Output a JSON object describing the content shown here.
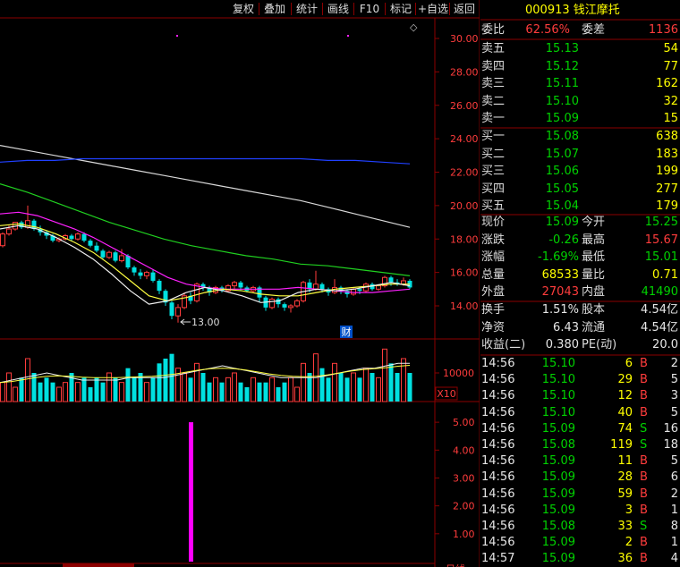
{
  "toolbar": {
    "buttons": [
      "复权",
      "叠加",
      "统计",
      "画线",
      "F10",
      "标记",
      "+自选",
      "返回"
    ]
  },
  "stock": {
    "code": "000913",
    "name": "钱江摩托"
  },
  "main_chart": {
    "price_ticks": [
      "30.00",
      "28.00",
      "26.00",
      "24.00",
      "22.00",
      "20.00",
      "18.00",
      "16.00",
      "14.00"
    ],
    "low_marker": "13.00",
    "finance_marker": "财",
    "diamond": "◇",
    "candles": [
      {
        "o": 17.6,
        "c": 18.3,
        "h": 18.4,
        "l": 17.5
      },
      {
        "o": 18.3,
        "c": 18.6,
        "h": 18.8,
        "l": 18.2
      },
      {
        "o": 18.6,
        "c": 19.0,
        "h": 19.0,
        "l": 18.5
      },
      {
        "o": 19.0,
        "c": 18.7,
        "h": 19.1,
        "l": 18.6
      },
      {
        "o": 18.7,
        "c": 19.1,
        "h": 20.0,
        "l": 18.6
      },
      {
        "o": 19.1,
        "c": 18.6,
        "h": 19.2,
        "l": 18.5
      },
      {
        "o": 18.6,
        "c": 18.4,
        "h": 18.8,
        "l": 18.2
      },
      {
        "o": 18.4,
        "c": 18.2,
        "h": 18.5,
        "l": 18.0
      },
      {
        "o": 18.2,
        "c": 17.9,
        "h": 18.3,
        "l": 17.8
      },
      {
        "o": 17.9,
        "c": 18.0,
        "h": 18.1,
        "l": 17.8
      },
      {
        "o": 18.0,
        "c": 18.2,
        "h": 18.3,
        "l": 17.9
      },
      {
        "o": 18.2,
        "c": 18.0,
        "h": 18.3,
        "l": 17.9
      },
      {
        "o": 18.0,
        "c": 18.3,
        "h": 18.4,
        "l": 17.9
      },
      {
        "o": 18.3,
        "c": 17.9,
        "h": 18.4,
        "l": 17.8
      },
      {
        "o": 17.9,
        "c": 17.6,
        "h": 18.0,
        "l": 17.5
      },
      {
        "o": 17.6,
        "c": 17.3,
        "h": 17.8,
        "l": 17.2
      },
      {
        "o": 17.3,
        "c": 16.9,
        "h": 17.4,
        "l": 16.8
      },
      {
        "o": 16.9,
        "c": 17.2,
        "h": 17.3,
        "l": 16.8
      },
      {
        "o": 17.2,
        "c": 16.7,
        "h": 17.3,
        "l": 16.6
      },
      {
        "o": 16.7,
        "c": 17.0,
        "h": 17.4,
        "l": 16.6
      },
      {
        "o": 17.0,
        "c": 16.3,
        "h": 17.1,
        "l": 16.2
      },
      {
        "o": 16.3,
        "c": 16.0,
        "h": 16.4,
        "l": 15.8
      },
      {
        "o": 16.0,
        "c": 15.8,
        "h": 16.2,
        "l": 15.6
      },
      {
        "o": 15.8,
        "c": 16.0,
        "h": 16.1,
        "l": 15.6
      },
      {
        "o": 16.0,
        "c": 15.5,
        "h": 16.2,
        "l": 15.4
      },
      {
        "o": 15.5,
        "c": 14.9,
        "h": 15.6,
        "l": 14.7
      },
      {
        "o": 14.9,
        "c": 14.2,
        "h": 15.0,
        "l": 14.0
      },
      {
        "o": 14.2,
        "c": 13.4,
        "h": 14.3,
        "l": 13.2
      },
      {
        "o": 13.4,
        "c": 13.9,
        "h": 14.1,
        "l": 13.0
      },
      {
        "o": 13.9,
        "c": 14.6,
        "h": 14.8,
        "l": 13.8
      },
      {
        "o": 14.6,
        "c": 14.3,
        "h": 14.8,
        "l": 14.1
      },
      {
        "o": 14.3,
        "c": 15.3,
        "h": 15.4,
        "l": 14.2
      },
      {
        "o": 15.3,
        "c": 15.1,
        "h": 15.4,
        "l": 14.9
      },
      {
        "o": 15.1,
        "c": 14.8,
        "h": 15.2,
        "l": 14.6
      },
      {
        "o": 14.8,
        "c": 15.1,
        "h": 15.2,
        "l": 14.7
      },
      {
        "o": 15.1,
        "c": 14.9,
        "h": 15.2,
        "l": 14.8
      },
      {
        "o": 14.9,
        "c": 15.2,
        "h": 15.3,
        "l": 14.8
      },
      {
        "o": 15.2,
        "c": 15.4,
        "h": 15.5,
        "l": 15.0
      },
      {
        "o": 15.4,
        "c": 15.1,
        "h": 15.5,
        "l": 14.9
      },
      {
        "o": 15.1,
        "c": 14.9,
        "h": 15.2,
        "l": 14.8
      },
      {
        "o": 14.9,
        "c": 15.1,
        "h": 15.2,
        "l": 14.8
      },
      {
        "o": 15.1,
        "c": 14.5,
        "h": 15.2,
        "l": 14.2
      },
      {
        "o": 14.5,
        "c": 13.9,
        "h": 14.6,
        "l": 13.7
      },
      {
        "o": 13.9,
        "c": 14.4,
        "h": 14.5,
        "l": 13.8
      },
      {
        "o": 14.4,
        "c": 14.1,
        "h": 14.5,
        "l": 13.9
      },
      {
        "o": 14.1,
        "c": 13.9,
        "h": 14.2,
        "l": 13.7
      },
      {
        "o": 13.9,
        "c": 14.0,
        "h": 14.1,
        "l": 13.6
      },
      {
        "o": 14.0,
        "c": 14.3,
        "h": 14.4,
        "l": 13.9
      },
      {
        "o": 14.3,
        "c": 15.4,
        "h": 15.5,
        "l": 14.2
      },
      {
        "o": 15.4,
        "c": 15.0,
        "h": 15.6,
        "l": 14.8
      },
      {
        "o": 15.0,
        "c": 15.3,
        "h": 16.1,
        "l": 14.9
      },
      {
        "o": 15.3,
        "c": 15.0,
        "h": 15.4,
        "l": 14.8
      },
      {
        "o": 15.0,
        "c": 14.8,
        "h": 15.1,
        "l": 14.6
      },
      {
        "o": 14.8,
        "c": 15.1,
        "h": 15.6,
        "l": 14.7
      },
      {
        "o": 15.1,
        "c": 14.9,
        "h": 15.2,
        "l": 14.7
      },
      {
        "o": 14.9,
        "c": 14.7,
        "h": 15.0,
        "l": 14.5
      },
      {
        "o": 14.7,
        "c": 15.0,
        "h": 15.1,
        "l": 14.6
      },
      {
        "o": 15.0,
        "c": 14.9,
        "h": 15.1,
        "l": 14.7
      },
      {
        "o": 14.9,
        "c": 15.3,
        "h": 15.4,
        "l": 14.8
      },
      {
        "o": 15.3,
        "c": 15.0,
        "h": 15.4,
        "l": 14.9
      },
      {
        "o": 15.0,
        "c": 15.2,
        "h": 15.3,
        "l": 14.9
      },
      {
        "o": 15.2,
        "c": 15.7,
        "h": 15.8,
        "l": 15.1
      },
      {
        "o": 15.7,
        "c": 15.4,
        "h": 15.8,
        "l": 15.2
      },
      {
        "o": 15.4,
        "c": 15.3,
        "h": 15.6,
        "l": 15.2
      },
      {
        "o": 15.3,
        "c": 15.5,
        "h": 15.7,
        "l": 15.2
      },
      {
        "o": 15.5,
        "c": 15.1,
        "h": 15.6,
        "l": 15.0
      }
    ],
    "ma_white": [
      23.6,
      23.3,
      23.0,
      22.7,
      22.4,
      22.1,
      21.8,
      21.5,
      21.2,
      20.9,
      20.6,
      20.3,
      19.9,
      19.5,
      19.1,
      18.7
    ],
    "ma_blue": [
      22.6,
      22.7,
      22.7,
      22.8,
      22.8,
      22.8,
      22.8,
      22.8,
      22.8,
      22.8,
      22.8,
      22.8,
      22.7,
      22.7,
      22.6,
      22.5
    ],
    "ma_green": [
      21.3,
      20.8,
      20.2,
      19.6,
      19.0,
      18.5,
      18.0,
      17.6,
      17.3,
      17.0,
      16.8,
      16.5,
      16.4,
      16.2,
      16.0,
      15.8
    ],
    "ma_magenta": [
      19.5,
      19.6,
      19.4,
      19.0,
      18.6,
      18.1,
      17.5,
      16.9,
      16.3,
      15.7,
      15.3,
      15.1,
      15.0,
      15.0,
      15.0,
      15.0,
      15.1,
      15.0,
      14.9,
      14.8,
      14.8,
      14.9,
      15.0
    ],
    "ma_yellow": [
      18.8,
      18.9,
      18.7,
      18.3,
      17.8,
      17.2,
      16.4,
      15.5,
      14.6,
      14.3,
      14.5,
      14.8,
      15.0,
      14.9,
      14.7,
      14.6,
      14.6,
      14.8,
      15.0,
      15.1,
      15.2,
      15.3,
      15.3
    ],
    "ma_cream": [
      18.6,
      18.8,
      18.6,
      18.1,
      17.5,
      16.8,
      15.9,
      14.9,
      14.1,
      14.3,
      14.8,
      15.1,
      14.9,
      14.6,
      14.2,
      14.3,
      14.8,
      15.0,
      14.9,
      15.0,
      15.2,
      15.4,
      15.2
    ]
  },
  "volume_chart": {
    "tick": "10000",
    "multiplier": "X10",
    "bars": [
      4,
      6,
      3,
      5,
      9,
      6,
      4,
      5,
      4,
      3,
      4,
      6,
      4,
      5,
      3,
      5,
      4,
      6,
      5,
      4,
      7,
      5,
      6,
      4,
      5,
      8,
      9,
      10,
      7,
      6,
      5,
      8,
      6,
      4,
      5,
      4,
      5,
      6,
      4,
      3,
      5,
      4,
      4,
      5,
      3,
      4,
      5,
      3,
      8,
      6,
      10,
      7,
      5,
      8,
      6,
      5,
      6,
      5,
      7,
      6,
      5,
      11,
      8,
      6,
      9,
      6
    ],
    "ma1": [
      4,
      4.5,
      5,
      5.5,
      6,
      5.5,
      5,
      4.5,
      4.5,
      4.5,
      4.5,
      5,
      5,
      5,
      5,
      5.5,
      6,
      6.5,
      7,
      7.5,
      7,
      6.5,
      6,
      5.5,
      5,
      5,
      5,
      5,
      5.5,
      6,
      6.5,
      7,
      7,
      7.5,
      8,
      8
    ],
    "ma2": [
      4,
      4.2,
      4.6,
      5,
      5.3,
      5.4,
      5.3,
      5.1,
      5,
      5,
      5,
      5.1,
      5.2,
      5.3,
      5.5,
      5.8,
      6.2,
      6.6,
      6.9,
      7,
      6.9,
      6.6,
      6.2,
      5.8,
      5.5,
      5.3,
      5.2,
      5.3,
      5.6,
      6,
      6.4,
      6.7,
      6.9,
      7.1,
      7.4,
      7.6
    ]
  },
  "indicator_chart": {
    "ticks": [
      "5.00",
      "4.00",
      "3.00",
      "2.00",
      "1.00"
    ],
    "bar_value": 5.0,
    "bottom_label": "日线"
  },
  "quote": {
    "weibi_label": "委比",
    "weibi": "62.56%",
    "weicha_label": "委差",
    "weicha": "1136",
    "sell": [
      {
        "label": "卖五",
        "price": "15.13",
        "vol": "54"
      },
      {
        "label": "卖四",
        "price": "15.12",
        "vol": "77"
      },
      {
        "label": "卖三",
        "price": "15.11",
        "vol": "162"
      },
      {
        "label": "卖二",
        "price": "15.10",
        "vol": "32"
      },
      {
        "label": "卖一",
        "price": "15.09",
        "vol": "15"
      }
    ],
    "buy": [
      {
        "label": "买一",
        "price": "15.08",
        "vol": "638"
      },
      {
        "label": "买二",
        "price": "15.07",
        "vol": "183"
      },
      {
        "label": "买三",
        "price": "15.06",
        "vol": "199"
      },
      {
        "label": "买四",
        "price": "15.05",
        "vol": "277"
      },
      {
        "label": "买五",
        "price": "15.04",
        "vol": "179"
      }
    ],
    "stats": [
      {
        "l1": "现价",
        "v1": "15.09",
        "c1": "dn",
        "l2": "今开",
        "v2": "15.25",
        "c2": "dn"
      },
      {
        "l1": "涨跌",
        "v1": "-0.26",
        "c1": "dn",
        "l2": "最高",
        "v2": "15.67",
        "c2": "up"
      },
      {
        "l1": "涨幅",
        "v1": "-1.69%",
        "c1": "dn",
        "l2": "最低",
        "v2": "15.01",
        "c2": "dn"
      },
      {
        "l1": "总量",
        "v1": "68533",
        "c1": "yel",
        "l2": "量比",
        "v2": "0.71",
        "c2": "yel"
      },
      {
        "l1": "外盘",
        "v1": "27043",
        "c1": "up",
        "l2": "内盘",
        "v2": "41490",
        "c2": "dn"
      }
    ],
    "finance": [
      {
        "l1": "换手",
        "v1": "1.51%",
        "l2": "股本",
        "v2": "4.54亿"
      },
      {
        "l1": "净资",
        "v1": "6.43",
        "l2": "流通",
        "v2": "4.54亿"
      },
      {
        "l1": "收益(二)",
        "v1": "0.380",
        "l2": "PE(动)",
        "v2": "20.0"
      }
    ]
  },
  "ticks": [
    {
      "time": "14:56",
      "price": "15.10",
      "vol": "6",
      "side": "B",
      "n": "2"
    },
    {
      "time": "14:56",
      "price": "15.10",
      "vol": "29",
      "side": "B",
      "n": "5"
    },
    {
      "time": "14:56",
      "price": "15.10",
      "vol": "12",
      "side": "B",
      "n": "3"
    },
    {
      "time": "14:56",
      "price": "15.10",
      "vol": "40",
      "side": "B",
      "n": "5"
    },
    {
      "time": "14:56",
      "price": "15.09",
      "vol": "74",
      "side": "S",
      "n": "16"
    },
    {
      "time": "14:56",
      "price": "15.08",
      "vol": "119",
      "side": "S",
      "n": "18"
    },
    {
      "time": "14:56",
      "price": "15.09",
      "vol": "11",
      "side": "B",
      "n": "5"
    },
    {
      "time": "14:56",
      "price": "15.09",
      "vol": "28",
      "side": "B",
      "n": "6"
    },
    {
      "time": "14:56",
      "price": "15.09",
      "vol": "59",
      "side": "B",
      "n": "2"
    },
    {
      "time": "14:56",
      "price": "15.09",
      "vol": "3",
      "side": "B",
      "n": "1"
    },
    {
      "time": "14:56",
      "price": "15.08",
      "vol": "33",
      "side": "S",
      "n": "8"
    },
    {
      "time": "14:56",
      "price": "15.09",
      "vol": "2",
      "side": "B",
      "n": "1"
    },
    {
      "time": "14:57",
      "price": "15.09",
      "vol": "36",
      "side": "B",
      "n": "4"
    }
  ],
  "colors": {
    "grid": "#8b0000",
    "up": "#ff3c3c",
    "down": "#00e0e0",
    "ma_white": "#d8d8d8",
    "ma_blue": "#2040ff",
    "ma_green": "#20d020",
    "ma_magenta": "#ff20ff",
    "ma_yellow": "#ffff40",
    "indicator": "#ff00ff"
  }
}
